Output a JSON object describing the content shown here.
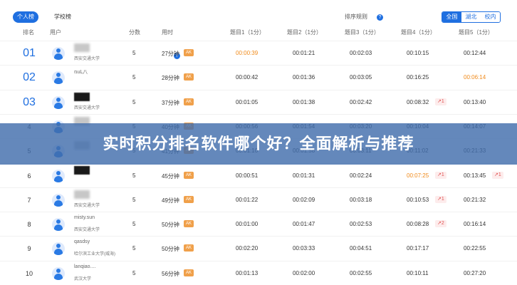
{
  "tabs": {
    "personal": "个人榜",
    "school": "学校榜"
  },
  "sort": {
    "label": "排序规则",
    "help": "?"
  },
  "scope": {
    "all": "全国",
    "province": "湖北",
    "campus": "校内"
  },
  "columns": {
    "rank": "排名",
    "user": "用户",
    "score": "分数",
    "time": "用时",
    "time_help": "?",
    "q1": "题目1（1分）",
    "q2": "题目2（1分）",
    "q3": "题目3（1分）",
    "q4": "题目4（1分）",
    "q5": "题目5（1分）"
  },
  "ak_label": "AK",
  "overlay_title": "实时积分排名软件哪个好？全面解析与推荐",
  "rows": [
    {
      "rank": "01",
      "name": "",
      "school": "西安交通大学",
      "score": "5",
      "time": "27分钟",
      "q": [
        "00:00:39",
        "00:01:21",
        "00:02:03",
        "00:10:15",
        "00:12:44"
      ],
      "t4": "",
      "t5": ""
    },
    {
      "rank": "02",
      "name": "ռuԼ八",
      "school": "",
      "score": "5",
      "time": "28分钟",
      "q": [
        "00:00:42",
        "00:01:36",
        "00:03:05",
        "00:16:25",
        "00:06:14"
      ],
      "t4": "",
      "t5": ""
    },
    {
      "rank": "03",
      "name": "",
      "school": "西安交通大学",
      "score": "5",
      "time": "37分钟",
      "q": [
        "00:01:05",
        "00:01:38",
        "00:02:42",
        "00:08:32",
        "00:13:40"
      ],
      "t4": "1",
      "t5": ""
    },
    {
      "rank": "4",
      "name": "",
      "school": "",
      "score": "5",
      "time": "40分钟",
      "q": [
        "00:00:56",
        "00:01:54",
        "00:03:20",
        "00:10:04",
        "00:14:07"
      ],
      "t4": "",
      "t5": ""
    },
    {
      "rank": "5",
      "name": "",
      "school": "",
      "score": "5",
      "time": "41分钟",
      "q": [
        "00:01:10",
        "00:01:58",
        "00:03:11",
        "00:11:02",
        "00:21:33"
      ],
      "t4": "",
      "t5": ""
    },
    {
      "rank": "6",
      "name": "",
      "school": "",
      "score": "5",
      "time": "45分钟",
      "q": [
        "00:00:51",
        "00:01:31",
        "00:02:24",
        "00:07:25",
        "00:13:45"
      ],
      "t4": "1",
      "t5": "1"
    },
    {
      "rank": "7",
      "name": "",
      "school": "西安交通大学",
      "score": "5",
      "time": "49分钟",
      "q": [
        "00:01:22",
        "00:02:09",
        "00:03:18",
        "00:10:53",
        "00:21:32"
      ],
      "t4": "1",
      "t5": ""
    },
    {
      "rank": "8",
      "name": "misty.sun",
      "school": "西安交通大学",
      "score": "5",
      "time": "50分钟",
      "q": [
        "00:01:00",
        "00:01:47",
        "00:02:53",
        "00:08:28",
        "00:16:14"
      ],
      "t4": "2",
      "t5": ""
    },
    {
      "rank": "9",
      "name": "qasdsy",
      "school": "哈尔滨工业大学(威海)",
      "score": "5",
      "time": "50分钟",
      "q": [
        "00:02:20",
        "00:03:33",
        "00:04:51",
        "00:17:17",
        "00:22:55"
      ],
      "t4": "",
      "t5": ""
    },
    {
      "rank": "10",
      "name": "lanqiao....",
      "school": "武汉大学",
      "score": "5",
      "time": "56分钟",
      "q": [
        "00:01:13",
        "00:02:00",
        "00:02:55",
        "00:10:11",
        "00:27:20"
      ],
      "t4": "",
      "t5": ""
    }
  ],
  "colors": {
    "accent": "#1f6fe0",
    "highlight": "#f08a1a",
    "ak_badge": "#f0a04a",
    "overlay": "#426eac"
  }
}
